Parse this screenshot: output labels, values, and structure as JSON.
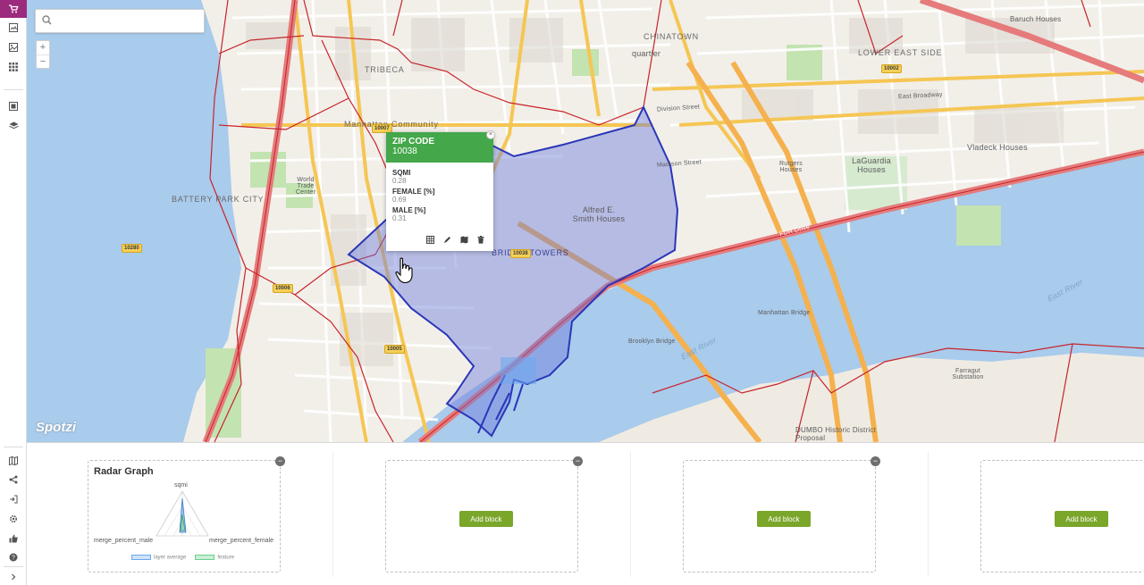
{
  "sidebar": {
    "top_items": [
      "cart-icon",
      "gallery-icon",
      "image-icon",
      "grid-icon",
      "widget-icon",
      "layers-icon"
    ],
    "bottom_items": [
      "map-icon",
      "share-icon",
      "export-icon",
      "settings-icon",
      "thumbs-up-icon",
      "help-icon",
      "chevron-right-icon"
    ]
  },
  "search": {
    "placeholder": "",
    "value": ""
  },
  "zoom": {
    "in_label": "+",
    "out_label": "−"
  },
  "map": {
    "brand": "Spotzi",
    "labels": {
      "chinatown": "CHINATOWN",
      "lower_east_side": "LOWER EAST SIDE",
      "tribeca": "TRIBECA",
      "battery_park_city": "BATTERY PARK CITY",
      "manhattan_community": "Manhattan Community",
      "quartier": "quartier",
      "alfred_smith": "Alfred E. Smith Houses",
      "laguardia": "LaGuardia Houses",
      "vladeck": "Vladeck Houses",
      "rutgers": "Rutgers Houses",
      "brooklyn_bridge": "Brooklyn Bridge",
      "manhattan_bridge": "Manhattan Bridge",
      "east_river_1": "East River",
      "east_river_2": "East River",
      "dumbo": "DUMBO Historic District Proposal",
      "farragut": "Farragut Substation",
      "baruch": "Baruch Houses",
      "east_broadway": "East Broadway",
      "division_street": "Division Street",
      "madison_street": "Madison Street",
      "world_trade": "World Trade Center",
      "bridge_towers": "BRIDGE TOWERS",
      "fdr_drive": "FDR Drive"
    },
    "zip_badges": [
      "10007",
      "10038",
      "10002",
      "10280",
      "10006",
      "10005"
    ]
  },
  "popup": {
    "title": "ZIP CODE",
    "value": "10038",
    "close_label": "×",
    "fields": [
      {
        "key": "SQMI",
        "value": "0.28"
      },
      {
        "key": "FEMALE [%]",
        "value": "0.69"
      },
      {
        "key": "MALE [%]",
        "value": "0.31"
      }
    ],
    "actions": [
      "table-icon",
      "edit-icon",
      "map-icon",
      "delete-icon"
    ]
  },
  "blocks": [
    {
      "title": "Radar Graph",
      "radar": {
        "axes": [
          "sqmi",
          "merge_percent_male",
          "merge_percent_female"
        ],
        "legend": [
          "layer average",
          "feature"
        ]
      }
    },
    {
      "add_label": "Add block"
    },
    {
      "add_label": "Add block"
    },
    {
      "add_label": "Add block"
    }
  ],
  "colors": {
    "accent": "#9c2a7d",
    "popup_header": "#44a74a",
    "add_button": "#7aa62a",
    "zip_highlight": "#6d7ddb",
    "zip_border": "#2a36b8",
    "boundary": "#c8242b"
  }
}
